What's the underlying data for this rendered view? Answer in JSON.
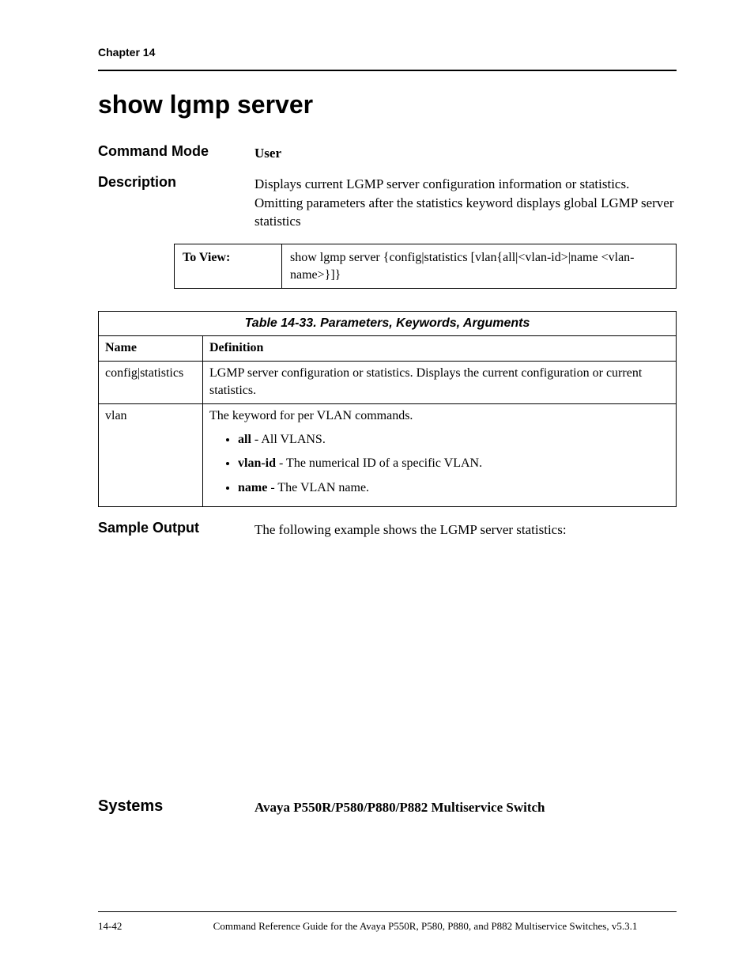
{
  "header": {
    "chapter": "Chapter 14"
  },
  "title": "show lgmp server",
  "command_mode": {
    "label": "Command Mode",
    "value": "User"
  },
  "description": {
    "label": "Description",
    "value": "Displays current LGMP server configuration information or statistics. Omitting parameters after the statistics keyword displays global LGMP server statistics"
  },
  "syntax": {
    "label": "To View:",
    "value": "show lgmp server {config|statistics [vlan{all|<vlan-id>|name <vlan-name>}]}"
  },
  "param_table": {
    "caption": "Table 14-33.  Parameters, Keywords, Arguments",
    "headers": {
      "name": "Name",
      "definition": "Definition"
    },
    "rows": [
      {
        "name": "config|statistics",
        "definition": "LGMP server configuration or statistics. Displays the current configuration or current statistics."
      },
      {
        "name": "vlan",
        "definition": "The keyword for per VLAN commands.",
        "bullets": [
          {
            "bold": "all",
            "rest": " - All VLANS."
          },
          {
            "bold": "vlan-id",
            "rest": " - The numerical ID of a specific VLAN."
          },
          {
            "bold": "name",
            "rest": " - The VLAN name."
          }
        ]
      }
    ]
  },
  "sample_output": {
    "label": "Sample Output",
    "value": "The following example shows the LGMP server statistics:"
  },
  "systems": {
    "label": "Systems",
    "value": "Avaya P550R/P580/P880/P882 Multiservice Switch"
  },
  "footer": {
    "page": "14-42",
    "text": "Command Reference Guide for the Avaya P550R, P580, P880, and P882 Multiservice Switches, v5.3.1"
  }
}
